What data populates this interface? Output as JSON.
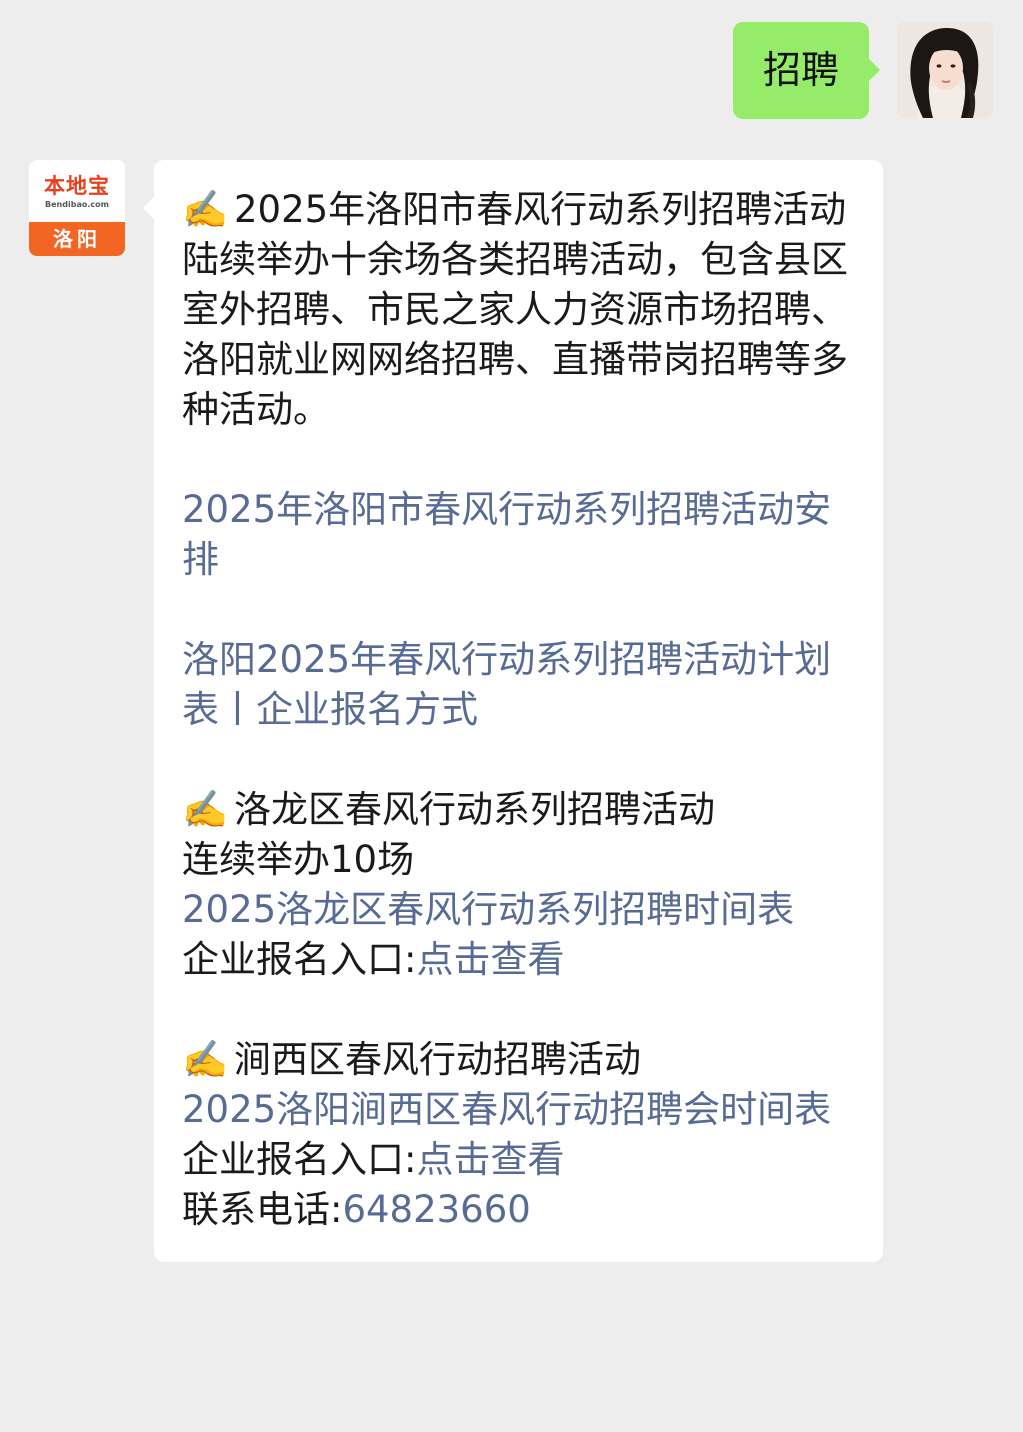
{
  "outgoing": {
    "text": "招聘"
  },
  "bot_avatar": {
    "brand": "本地宝",
    "domain": "Bendibao.com",
    "city": "洛阳"
  },
  "incoming": {
    "emoji": "✍️",
    "s1_title": "2025年洛阳市春风行动系列招聘活动",
    "s1_desc": "陆续举办十余场各类招聘活动，包含县区室外招聘、市民之家人力资源市场招聘、洛阳就业网网络招聘、直播带岗招聘等多种活动。",
    "link1": "2025年洛阳市春风行动系列招聘活动安排",
    "link2": "洛阳2025年春风行动系列招聘活动计划表丨企业报名方式",
    "s2_title": "洛龙区春风行动系列招聘活动",
    "s2_desc": "连续举办10场",
    "s2_link": "2025洛龙区春风行动系列招聘时间表",
    "s2_signup_label": "企业报名入口:",
    "s2_signup_link": "点击查看",
    "s3_title": "涧西区春风行动招聘活动",
    "s3_link": "2025洛阳涧西区春风行动招聘会时间表",
    "s3_signup_label": "企业报名入口:",
    "s3_signup_link": "点击查看",
    "phone_label": "联系电话:",
    "phone_number": "64823660"
  },
  "colors": {
    "outgoing_bubble": "#95ec69",
    "link": "#576b95",
    "background": "#ededed",
    "brand": "#f26522"
  }
}
